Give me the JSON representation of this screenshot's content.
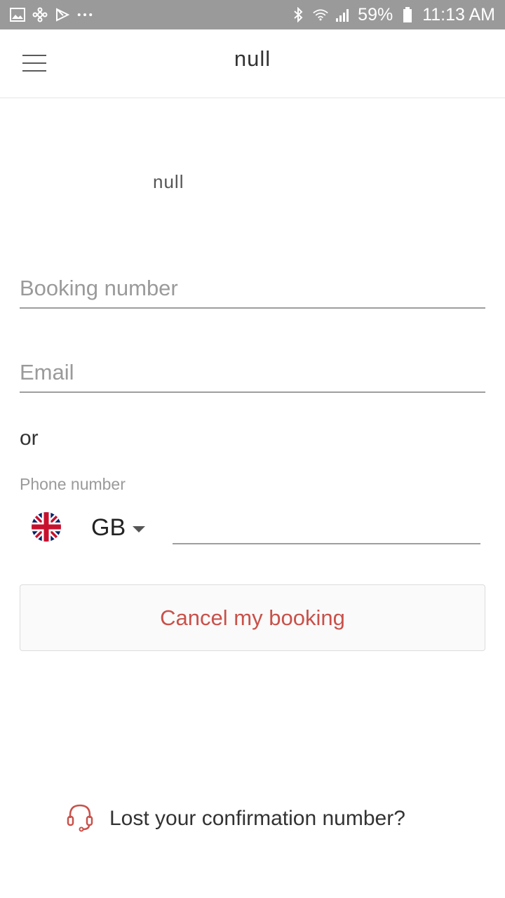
{
  "status_bar": {
    "battery": "59%",
    "time": "11:13 AM",
    "icons": [
      "gallery-icon",
      "pinwheel-icon",
      "play-store-icon",
      "more-dots-icon",
      "bluetooth-icon",
      "wifi-icon",
      "signal-icon",
      "battery-icon"
    ]
  },
  "appbar": {
    "title": "null",
    "menu_icon": "hamburger-menu-icon"
  },
  "page": {
    "subtitle": "null",
    "booking_placeholder": "Booking number",
    "email_placeholder": "Email",
    "or_text": "or",
    "phone_label": "Phone number",
    "country_code": "GB",
    "cancel_button": "Cancel my booking",
    "lost_link": "Lost your confirmation number?"
  },
  "colors": {
    "accent": "#c9514a",
    "status_bar": "#9a9a9a"
  }
}
